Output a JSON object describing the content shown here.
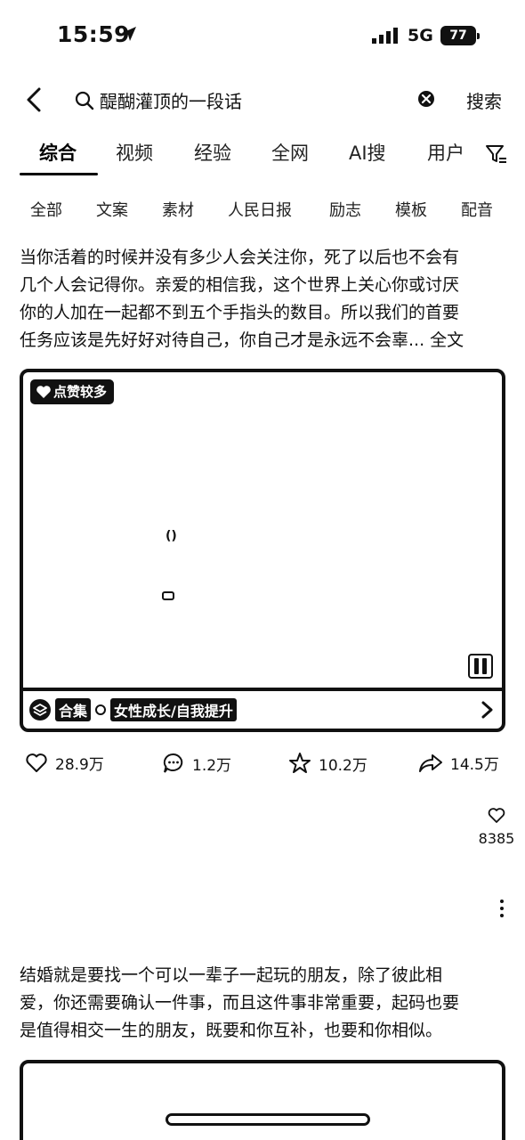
{
  "status": {
    "time": "15:59",
    "network": "5G",
    "battery": "77"
  },
  "search": {
    "query": "醍醐灌顶的一段话",
    "submit_label": "搜索"
  },
  "tabs": [
    {
      "label": "综合",
      "active": true
    },
    {
      "label": "视频"
    },
    {
      "label": "经验"
    },
    {
      "label": "全网"
    },
    {
      "label": "AI搜"
    },
    {
      "label": "用户"
    }
  ],
  "subtabs": [
    "全部",
    "文案",
    "素材",
    "人民日报",
    "励志",
    "模板",
    "配音"
  ],
  "post1": {
    "lines": [
      "当你活着的时候并没有多少人会关注你，死了以后也不会有",
      "几个人会记得你。亲爱的相信我，这个世界上关心你或讨厌",
      "你的人加在一起都不到五个手指头的数目。所以我们的首要",
      "任务应该是先好好对待自己，你自己才是永远不会辜..."
    ],
    "more_label": "全文",
    "badge": "点赞较多",
    "center_mark": "()",
    "collection_label": "合集",
    "collection_name": "女性成长/自我提升",
    "likes": "28.9万",
    "comments": "1.2万",
    "favorites": "10.2万",
    "shares": "14.5万"
  },
  "side_like_count": "8385",
  "post2": {
    "lines": [
      "结婚就是要找一个可以一辈子一起玩的朋友，除了彼此相",
      "爱，你还需要确认一件事，而且这件事非常重要，起码也要",
      "是值得相交一生的朋友，既要和你互补，也要和你相似。"
    ]
  }
}
